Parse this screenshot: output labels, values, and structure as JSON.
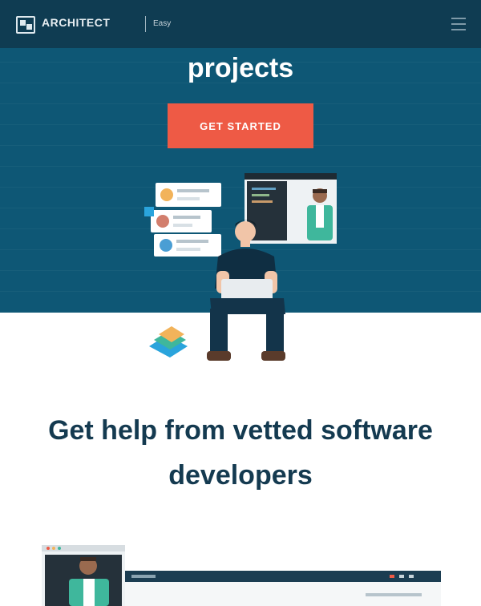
{
  "nav": {
    "brand": "ARCHITECT",
    "sub": "Easy",
    "menu_icon": "hamburger-menu-icon"
  },
  "hero": {
    "title": "projects",
    "cta_label": "GET STARTED"
  },
  "section": {
    "title": "Get help from vetted software developers"
  },
  "colors": {
    "nav_bg": "#0f3c52",
    "hero_bg": "#0e5775",
    "cta": "#ee5a45",
    "heading": "#143a50"
  }
}
